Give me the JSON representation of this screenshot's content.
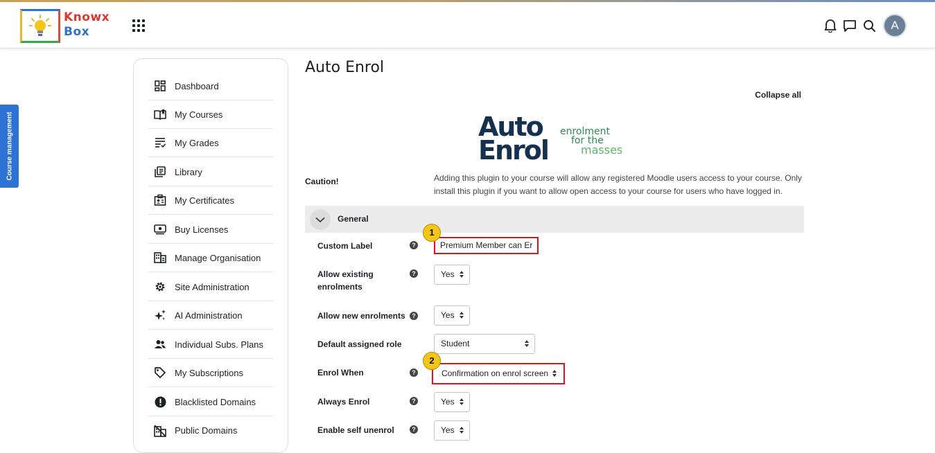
{
  "brand": {
    "line1": "Knowx",
    "line2": "Box"
  },
  "user": {
    "initial": "A"
  },
  "course_tab": "Course management",
  "sidebar": {
    "items": [
      {
        "label": "Dashboard",
        "icon": "dashboard-icon"
      },
      {
        "label": "My Courses",
        "icon": "book-icon"
      },
      {
        "label": "My Grades",
        "icon": "grades-icon"
      },
      {
        "label": "Library",
        "icon": "library-icon"
      },
      {
        "label": "My Certificates",
        "icon": "certificate-icon"
      },
      {
        "label": "Buy Licenses",
        "icon": "license-icon"
      },
      {
        "label": "Manage Organisation",
        "icon": "organisation-icon"
      },
      {
        "label": "Site Administration",
        "icon": "gear-icon"
      },
      {
        "label": "AI Administration",
        "icon": "sparkle-icon"
      },
      {
        "label": "Individual Subs. Plans",
        "icon": "users-icon"
      },
      {
        "label": "My Subscriptions",
        "icon": "tag-icon"
      },
      {
        "label": "Blacklisted Domains",
        "icon": "alert-icon"
      },
      {
        "label": "Public Domains",
        "icon": "domain-icon"
      }
    ]
  },
  "main": {
    "title": "Auto Enrol",
    "collapse_all": "Collapse all",
    "plugin_logo": {
      "big1": "Auto",
      "big2": "Enrol",
      "small1": "enrolment",
      "small2": "for the",
      "small3": "masses"
    },
    "caution_label": "Caution!",
    "caution_text": "Adding this plugin to your course will allow any registered Moodle users access to your course. Only install this plugin if you want to allow open access to your course for users who have logged in.",
    "section": "General",
    "help_glyph": "?",
    "fields": {
      "custom_label": {
        "label": "Custom Label",
        "value": "Premium Member can Er"
      },
      "allow_existing": {
        "label": "Allow existing enrolments",
        "value": "Yes"
      },
      "allow_new": {
        "label": "Allow new enrolments",
        "value": "Yes"
      },
      "default_role": {
        "label": "Default assigned role",
        "value": "Student"
      },
      "enrol_when": {
        "label": "Enrol When",
        "value": "Confirmation on enrol screen"
      },
      "always_enrol": {
        "label": "Always Enrol",
        "value": "Yes"
      },
      "self_unenrol": {
        "label": "Enable self unenrol",
        "value": "Yes"
      }
    },
    "markers": [
      "1",
      "2"
    ]
  }
}
